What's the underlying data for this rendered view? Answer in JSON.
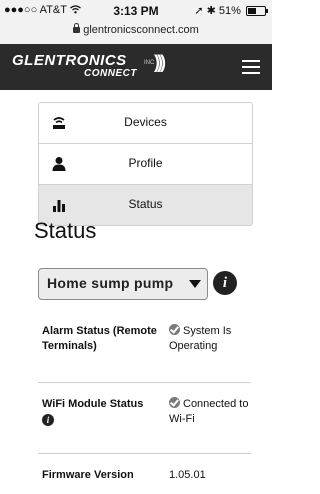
{
  "status_bar": {
    "carrier": "●●●○○ AT&T",
    "time": "3:13 PM",
    "battery": "51%",
    "battery_level": 0.51,
    "url": "glentronicsconnect.com"
  },
  "header": {
    "logo_main": "GLENTRONICS",
    "logo_sub": "CONNECT",
    "logo_inc": "INC"
  },
  "nav": {
    "items": [
      {
        "label": "Devices",
        "icon": "router-icon"
      },
      {
        "label": "Profile",
        "icon": "person-icon"
      },
      {
        "label": "Status",
        "icon": "bar-chart-icon",
        "active": true
      }
    ]
  },
  "page": {
    "title": "Status",
    "device_select": "Home sump pump"
  },
  "status_table": [
    {
      "label": "Alarm Status (Remote Terminals)",
      "value": "System Is Operating",
      "icon": "check-circle-icon"
    },
    {
      "label": "WiFi Module Status",
      "value": "Connected to Wi-Fi",
      "icon": "check-circle-icon",
      "info": true
    },
    {
      "label": "Firmware Version",
      "value": "1.05.01"
    }
  ],
  "colors": {
    "header_bg": "#2b2b2b",
    "active_nav_bg": "#e6e6e6",
    "check_icon": "#7a7a7a"
  }
}
